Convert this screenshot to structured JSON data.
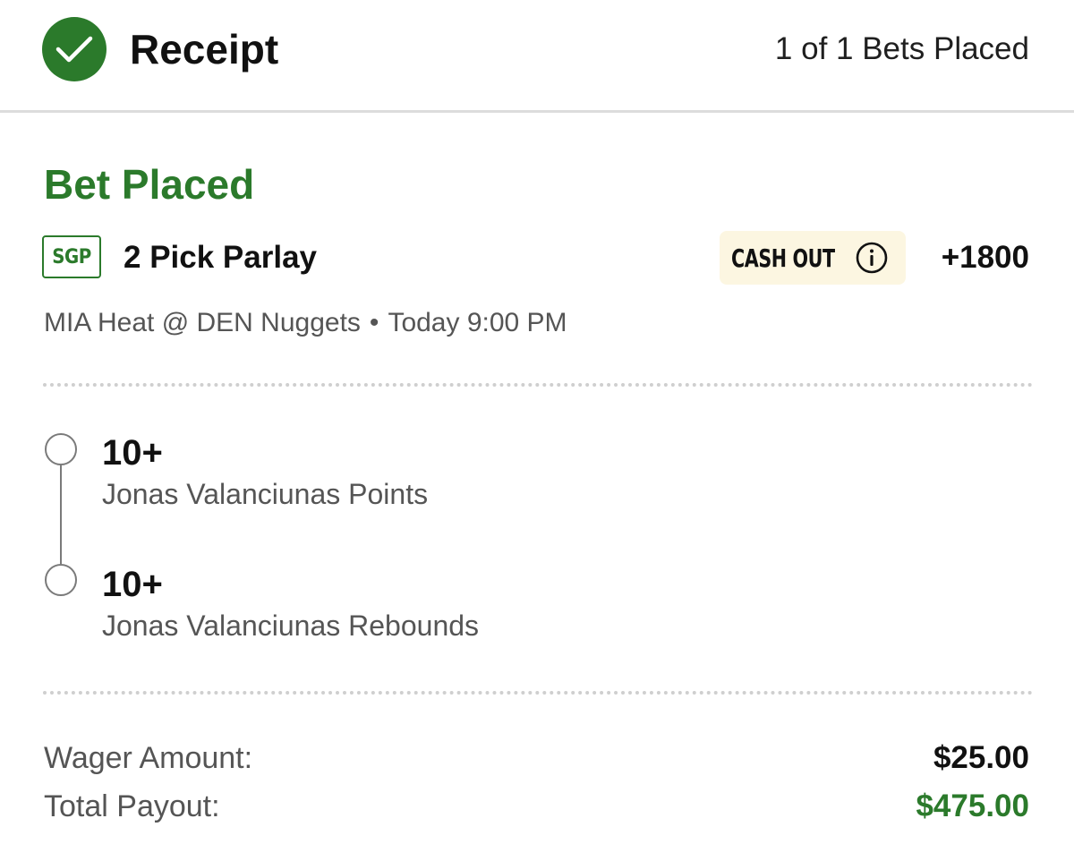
{
  "header": {
    "title": "Receipt",
    "bets_count": "1 of 1 Bets Placed",
    "icon": "check-circle-icon"
  },
  "bet": {
    "status": "Bet Placed",
    "badge": "SGP",
    "title": "2 Pick Parlay",
    "cashout_label": "CASH OUT",
    "odds": "+1800",
    "matchup": "MIA Heat @ DEN Nuggets",
    "separator": "•",
    "time": "Today 9:00 PM",
    "legs": [
      {
        "value": "10+",
        "description": "Jonas Valanciunas Points"
      },
      {
        "value": "10+",
        "description": "Jonas Valanciunas Rebounds"
      }
    ]
  },
  "totals": {
    "wager_label": "Wager Amount:",
    "wager_value": "$25.00",
    "payout_label": "Total Payout:",
    "payout_value": "$475.00"
  },
  "colors": {
    "brand_green": "#2b7a2b",
    "cashout_bg": "#fcf6e1",
    "muted_text": "#555555"
  }
}
